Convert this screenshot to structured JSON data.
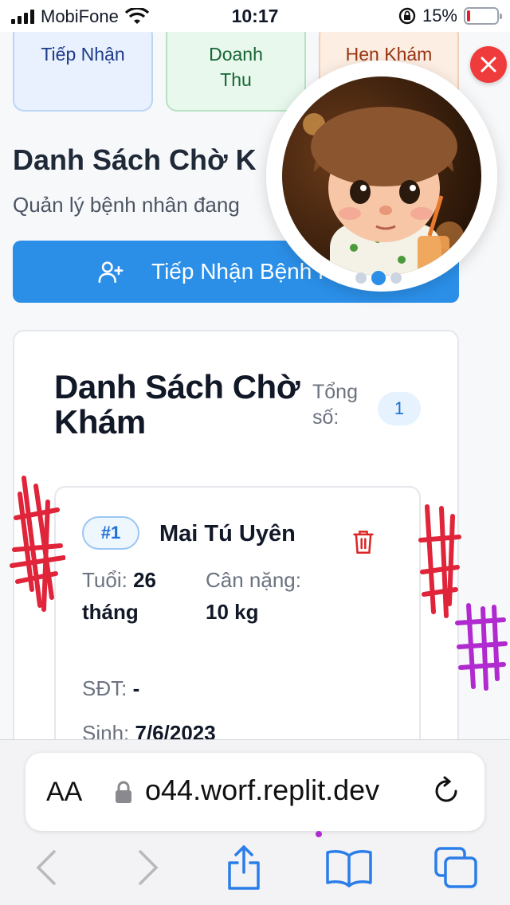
{
  "status_bar": {
    "carrier": "MobiFone",
    "time": "10:17",
    "battery": "15%"
  },
  "tiles": [
    {
      "label": "Tiếp Nhận"
    },
    {
      "label": "Doanh Thu"
    },
    {
      "label": "Hẹn Khám"
    }
  ],
  "page": {
    "title": "Danh Sách Chờ K",
    "subtitle": "Quản lý bệnh nhân đang",
    "primary_button": "Tiếp Nhận Bệnh N"
  },
  "waitlist": {
    "title": "Danh Sách Chờ Khám",
    "total_label": "Tổng số:",
    "total_count": "1",
    "patients": [
      {
        "index": "#1",
        "name": "Mai Tú Uyên",
        "age_label": "Tuổi:",
        "age_value": "26 tháng",
        "weight_label": "Cân nặng:",
        "weight_value": "10 kg",
        "phone_label": "SĐT:",
        "phone_value": "-",
        "dob_label": "Sinh:",
        "dob_value": "7/6/2023"
      }
    ]
  },
  "browser": {
    "aa_label": "AA",
    "url": "o44.worf.replit.dev"
  },
  "colors": {
    "primary": "#2b8fe8",
    "danger": "#e11d2e",
    "badge_bg": "#e6f2fd"
  }
}
